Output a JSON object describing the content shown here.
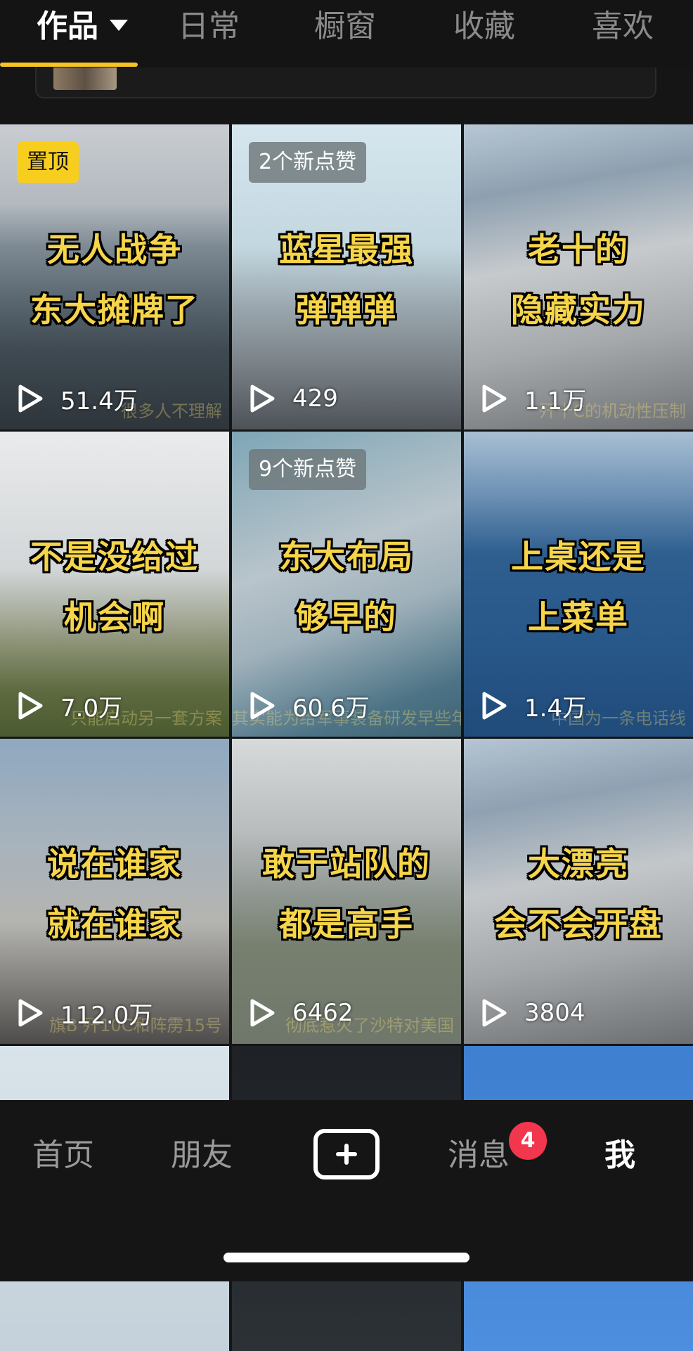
{
  "tabs": [
    {
      "label": "作品",
      "active": true
    },
    {
      "label": "日常",
      "active": false
    },
    {
      "label": "橱窗",
      "active": false
    },
    {
      "label": "收藏",
      "active": false
    },
    {
      "label": "喜欢",
      "active": false
    }
  ],
  "colors": {
    "accent": "#f6c524",
    "caption": "#f6d54a",
    "badge_red": "#f2364d",
    "background": "#151515"
  },
  "videos": [
    {
      "caption_line1": "无人战争",
      "caption_line2": "东大摊牌了",
      "badge": "置顶",
      "plays": "51.4万",
      "subtitle": "很多人不理解"
    },
    {
      "caption_line1": "蓝星最强",
      "caption_line2": "弹弹弹",
      "badge": "2个新点赞",
      "plays": "429",
      "subtitle": ""
    },
    {
      "caption_line1": "老十的",
      "caption_line2": "隐藏实力",
      "badge": "",
      "plays": "1.1万",
      "subtitle": "歼十C的机动性压制"
    },
    {
      "caption_line1": "不是没给过",
      "caption_line2": "机会啊",
      "badge": "",
      "plays": "7.0万",
      "subtitle": "只能启动另一套方案"
    },
    {
      "caption_line1": "东大布局",
      "caption_line2": "够早的",
      "badge": "9个新点赞",
      "plays": "60.6万",
      "subtitle": "其实能为给军事装备研发早些年"
    },
    {
      "caption_line1": "上桌还是",
      "caption_line2": "上菜单",
      "badge": "",
      "plays": "1.4万",
      "subtitle": "中国为一条电话线"
    },
    {
      "caption_line1": "说在谁家",
      "caption_line2": "就在谁家",
      "badge": "",
      "plays": "112.0万",
      "subtitle": "旗B 歼10C和阵雳15号"
    },
    {
      "caption_line1": "敢于站队的",
      "caption_line2": "都是高手",
      "badge": "",
      "plays": "6462",
      "subtitle": "彻底惹火了沙特对美国"
    },
    {
      "caption_line1": "大漂亮",
      "caption_line2": "会不会开盘",
      "badge": "",
      "plays": "3804",
      "subtitle": ""
    }
  ],
  "bottom_nav": {
    "home": "首页",
    "friends": "朋友",
    "create_icon": "plus-square-icon",
    "messages": "消息",
    "messages_badge": "4",
    "me": "我"
  }
}
